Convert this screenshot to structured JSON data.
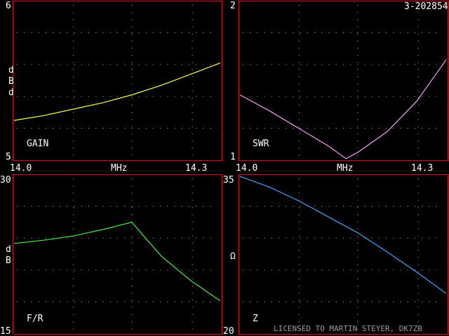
{
  "header": {
    "id_text": "3-202854"
  },
  "footer": {
    "license": "LICENSED TO MARTIN STEYER, DK7ZB"
  },
  "chart_data": [
    {
      "type": "line",
      "title": "GAIN",
      "ylabel": "dBd",
      "ylim": [
        5,
        6
      ],
      "xlim": [
        14.0,
        14.35
      ],
      "y_tick_labels": [
        "6",
        "5"
      ],
      "x_tick_labels": [
        "14.0",
        "MHz",
        "14.3"
      ],
      "grid": true,
      "color": "#ffff44",
      "x": [
        14.0,
        14.05,
        14.1,
        14.15,
        14.2,
        14.25,
        14.3,
        14.35
      ],
      "y": [
        5.25,
        5.28,
        5.32,
        5.36,
        5.41,
        5.47,
        5.54,
        5.61
      ]
    },
    {
      "type": "line",
      "title": "SWR",
      "ylabel": "",
      "ylim": [
        1,
        2
      ],
      "xlim": [
        14.0,
        14.35
      ],
      "y_tick_labels": [
        "2",
        "1"
      ],
      "x_tick_labels": [
        "14.0",
        "MHz",
        "14.3"
      ],
      "grid": true,
      "color": "#ff99ff",
      "x": [
        14.0,
        14.05,
        14.1,
        14.15,
        14.18,
        14.2,
        14.25,
        14.3,
        14.35
      ],
      "y": [
        1.41,
        1.31,
        1.2,
        1.09,
        1.01,
        1.05,
        1.18,
        1.37,
        1.63
      ]
    },
    {
      "type": "line",
      "title": "F/R",
      "ylabel": "dB",
      "ylim": [
        15,
        30
      ],
      "xlim": [
        14.0,
        14.35
      ],
      "y_tick_labels": [
        "30",
        "15"
      ],
      "grid": true,
      "color": "#44ee44",
      "x": [
        14.0,
        14.05,
        14.1,
        14.15,
        14.2,
        14.22,
        14.25,
        14.3,
        14.35
      ],
      "y": [
        23.5,
        23.8,
        24.2,
        24.8,
        25.5,
        24.2,
        22.3,
        20.0,
        18.1
      ]
    },
    {
      "type": "line",
      "title": "Z",
      "ylabel": "Ω",
      "ylim": [
        20,
        35
      ],
      "xlim": [
        14.0,
        14.35
      ],
      "y_tick_labels": [
        "35",
        "20"
      ],
      "grid": true,
      "color": "#33aaff",
      "x": [
        14.0,
        14.05,
        14.1,
        14.15,
        14.2,
        14.25,
        14.3,
        14.35
      ],
      "y": [
        34.8,
        33.8,
        32.5,
        31.0,
        29.5,
        27.7,
        25.8,
        23.8
      ]
    }
  ]
}
